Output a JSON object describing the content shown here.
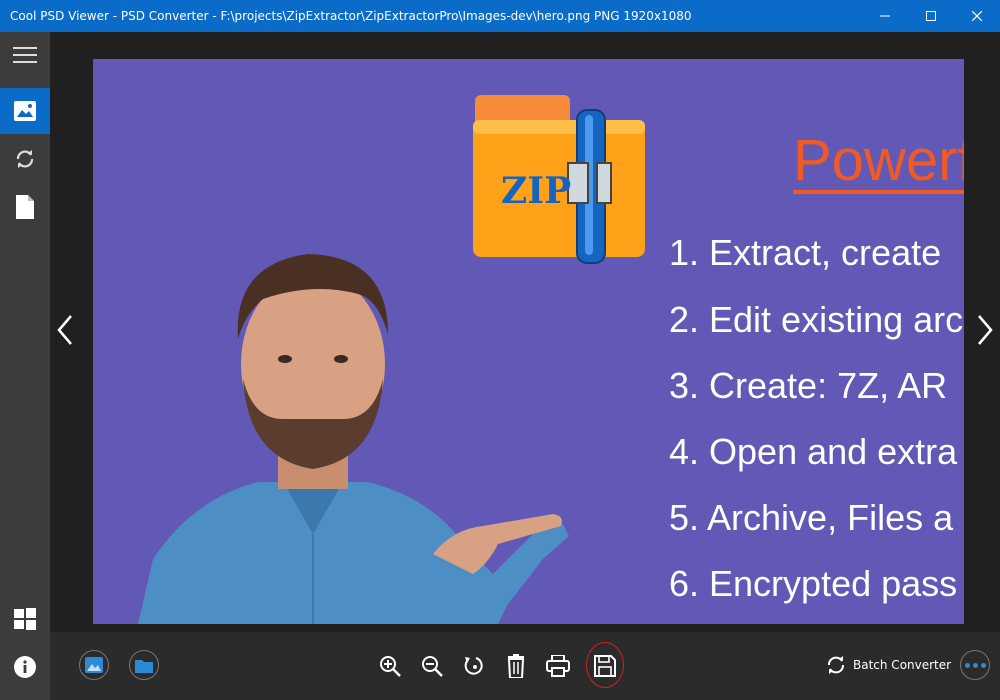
{
  "window": {
    "title": "Cool PSD Viewer - PSD Converter - F:\\projects\\ZipExtractor\\ZipExtractorPro\\Images-dev\\hero.png PNG 1920x1080",
    "controls": [
      "minimize-icon",
      "maximize-icon",
      "close-icon"
    ]
  },
  "sidebar": {
    "items": [
      {
        "icon": "hamburger-menu-icon",
        "active": false
      },
      {
        "icon": "image-icon",
        "active": true
      },
      {
        "icon": "sync-icon",
        "active": false
      },
      {
        "icon": "document-icon",
        "active": false
      },
      {
        "icon": "windows-logo-icon",
        "active": false
      },
      {
        "icon": "info-icon",
        "active": false
      }
    ]
  },
  "image": {
    "logo_text": "ZIP",
    "headline": "Powerf",
    "features": [
      "1. Extract, create",
      "2. Edit existing arc",
      "3. Create: 7Z, AR",
      "4. Open and extra",
      "5. Archive, Files a",
      "6. Encrypted pass"
    ],
    "colors": {
      "background": "#6159b5",
      "headline": "#f15a24",
      "folder": "#ffa21a",
      "zipper": "#1565c0"
    }
  },
  "toolbar": {
    "left_buttons": [
      "gallery-icon",
      "open-folder-icon"
    ],
    "center_buttons": [
      "zoom-in-icon",
      "zoom-out-icon",
      "rotate-icon",
      "delete-icon",
      "print-icon",
      "save-icon"
    ],
    "batch_label": "Batch Converter"
  },
  "colors": {
    "accent": "#0a6cc8",
    "sidebar": "#3c3c3c",
    "viewer": "#202020"
  }
}
